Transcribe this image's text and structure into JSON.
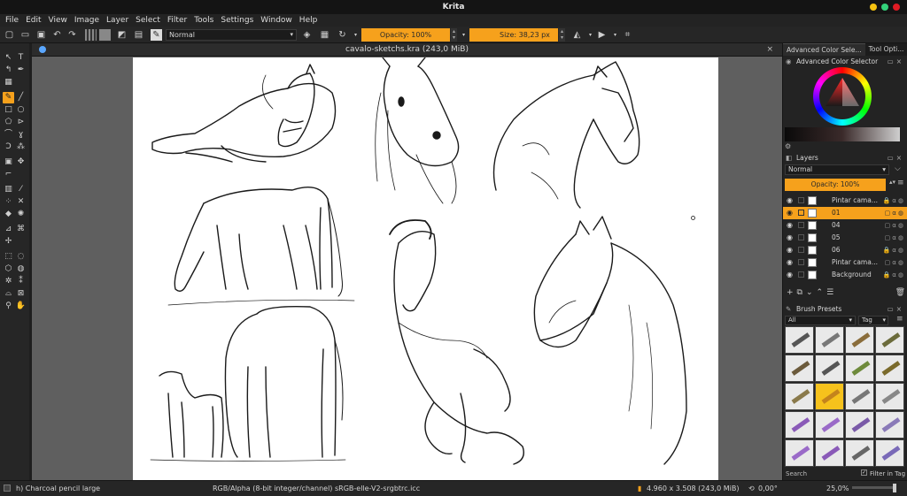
{
  "app": {
    "title": "Krita"
  },
  "menu": [
    "File",
    "Edit",
    "View",
    "Image",
    "Layer",
    "Select",
    "Filter",
    "Tools",
    "Settings",
    "Window",
    "Help"
  ],
  "tool_options": {
    "blend_mode": "Normal",
    "opacity": "Opacity: 100%",
    "size": "Size: 38,23 px"
  },
  "document": {
    "tab_title": "cavalo-sketchs.kra (243,0 MiB)"
  },
  "dock": {
    "tabs": [
      "Advanced Color Sele...",
      "Tool Opti..."
    ],
    "color_selector_title": "Advanced Color Selector",
    "layers_title": "Layers",
    "layers_blend": "Normal",
    "layers_opacity": "Opacity: 100%",
    "layers": [
      {
        "name": "Pintar cama...",
        "selected": false
      },
      {
        "name": "01",
        "selected": true
      },
      {
        "name": "04",
        "selected": false
      },
      {
        "name": "05",
        "selected": false
      },
      {
        "name": "06",
        "selected": false
      },
      {
        "name": "Pintar cama...",
        "selected": false
      },
      {
        "name": "Background",
        "selected": false
      }
    ],
    "brush_presets_title": "Brush Presets",
    "brush_filter": "All",
    "brush_tag": "Tag",
    "search_placeholder": "Search",
    "filter_in_tag": "Filter in Tag"
  },
  "status": {
    "brush": "h) Charcoal pencil large",
    "color_space": "RGB/Alpha (8-bit integer/channel)  sRGB-elle-V2-srgbtrc.icc",
    "dimensions": "4.960 x 3.508 (243,0 MiB)",
    "rotation": "0,00°",
    "zoom": "25,0%"
  },
  "colors": {
    "accent": "#f6a11c",
    "window_btn_yellow": "#f5c211",
    "window_btn_green": "#33d17a",
    "window_btn_red": "#e01b24"
  }
}
